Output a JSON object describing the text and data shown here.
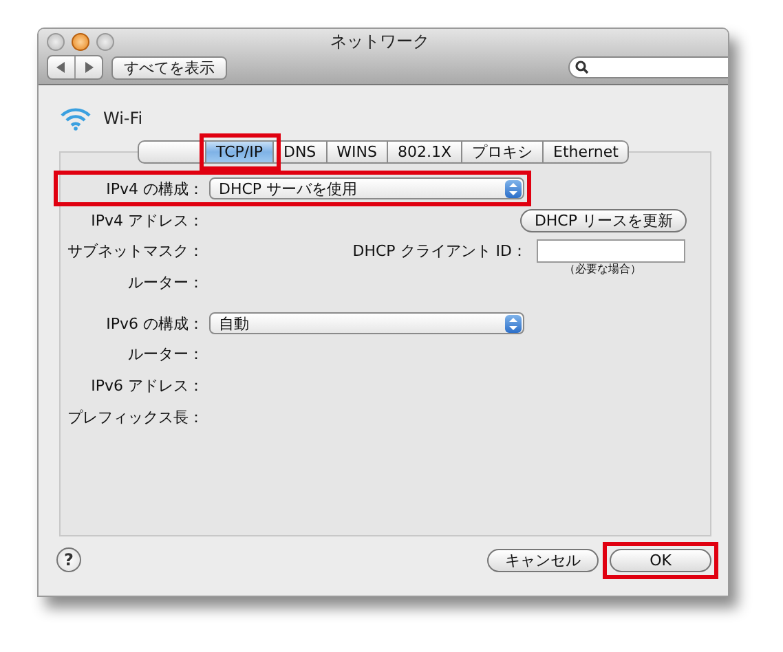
{
  "window": {
    "title": "ネットワーク"
  },
  "toolbar": {
    "show_all_button": "すべてを表示"
  },
  "network": {
    "name": "Wi-Fi"
  },
  "tabs": [
    {
      "label": "TCP/IP",
      "selected": true,
      "highlighted": true
    },
    {
      "label": "DNS",
      "selected": false,
      "highlighted": false
    },
    {
      "label": "WINS",
      "selected": false,
      "highlighted": false
    },
    {
      "label": "802.1X",
      "selected": false,
      "highlighted": false
    },
    {
      "label": "プロキシ",
      "selected": false,
      "highlighted": false
    },
    {
      "label": "Ethernet",
      "selected": false,
      "highlighted": false
    }
  ],
  "ipv4": [
    {
      "kind": "popup",
      "label": "IPv4 の構成：",
      "value": "DHCP サーバを使用",
      "highlighted": true
    },
    {
      "kind": "info",
      "label": "IPv4 アドレス："
    },
    {
      "kind": "info",
      "label": "サブネットマスク："
    },
    {
      "kind": "info",
      "label": "ルーター："
    }
  ],
  "dhcp": {
    "renew_button": "DHCP リースを更新",
    "client_id_label": "DHCP クライアント ID：",
    "hint": "（必要な場合）"
  },
  "ipv6": [
    {
      "kind": "popup",
      "label": "IPv6 の構成：",
      "value": "自動",
      "highlighted": false
    },
    {
      "kind": "info",
      "label": "ルーター："
    },
    {
      "kind": "info",
      "label": "IPv6 アドレス："
    },
    {
      "kind": "info",
      "label": "プレフィックス長："
    }
  ],
  "help_button": "?",
  "buttons": [
    {
      "label": "キャンセル",
      "highlighted": false
    },
    {
      "label": "OK",
      "highlighted": true
    }
  ]
}
